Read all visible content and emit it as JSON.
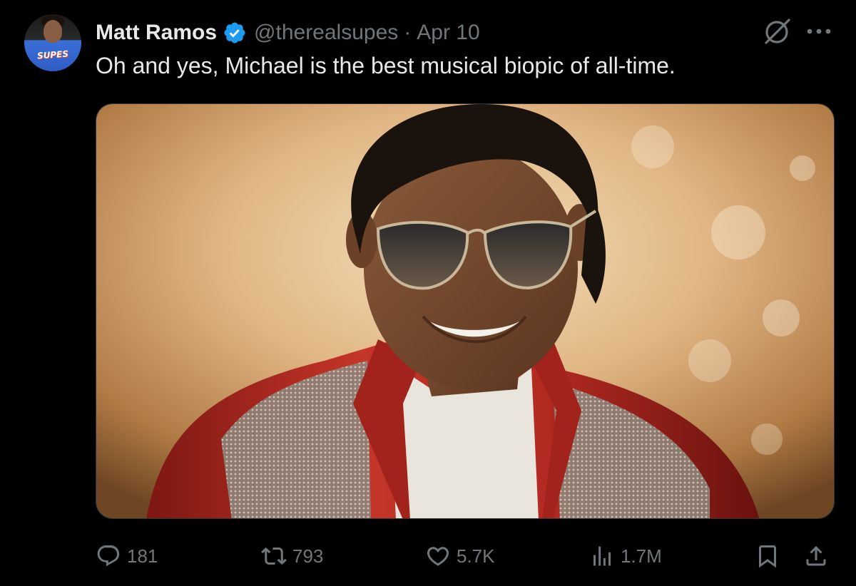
{
  "author": {
    "name": "Matt Ramos",
    "handle": "@therealsupes",
    "separator": "·",
    "date": "Apr 10",
    "avatar_shirt_text": "SUPES"
  },
  "tweet": {
    "text": "Oh and yes, Michael is the best musical biopic of all-time."
  },
  "icons": {
    "verified": "verified-badge-icon",
    "grok": "grok-icon",
    "more": "more-icon"
  },
  "actions": {
    "replies": "181",
    "reposts": "793",
    "likes": "5.7K",
    "views": "1.7M"
  },
  "colors": {
    "background": "#000000",
    "text": "#e7e9ea",
    "muted": "#71767b",
    "verified": "#1d9bf0"
  }
}
